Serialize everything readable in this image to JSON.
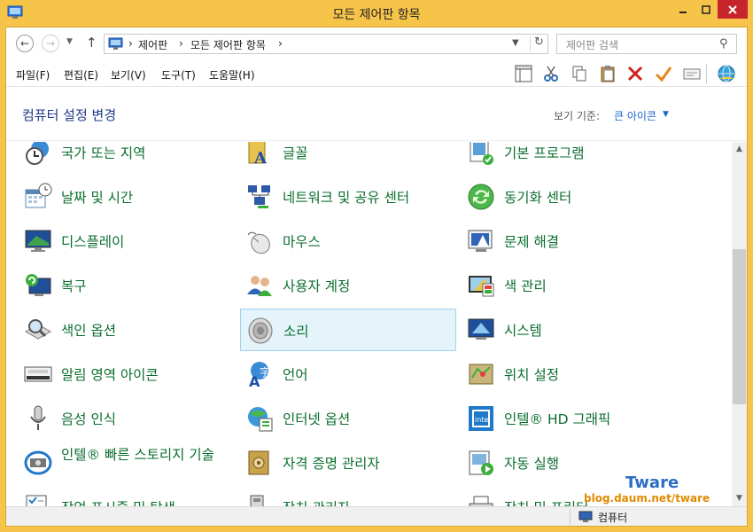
{
  "window": {
    "title": "모든 제어판 항목"
  },
  "nav": {
    "breadcrumbs": [
      "제어판",
      "모든 제어판 항목"
    ],
    "search_placeholder": "제어판 검색"
  },
  "menu": [
    "파일(F)",
    "편집(E)",
    "보기(V)",
    "도구(T)",
    "도움말(H)"
  ],
  "toolbar_icons": [
    "layout-pane-icon",
    "cut-icon",
    "copy-icon",
    "paste-icon",
    "delete-icon",
    "check-icon",
    "properties-icon",
    "globe-icon"
  ],
  "header": {
    "title": "컴퓨터 설정 변경",
    "view_by_label": "보기 기준:",
    "view_by_value": "큰 아이콘"
  },
  "items": [
    {
      "label": "국가 또는 지역",
      "icon": "clock-globe-icon"
    },
    {
      "label": "글꼴",
      "icon": "font-folder-icon"
    },
    {
      "label": "기본 프로그램",
      "icon": "default-programs-icon"
    },
    {
      "label": "날짜 및 시간",
      "icon": "calendar-clock-icon"
    },
    {
      "label": "네트워크 및 공유 센터",
      "icon": "network-icon"
    },
    {
      "label": "동기화 센터",
      "icon": "sync-icon"
    },
    {
      "label": "디스플레이",
      "icon": "display-icon"
    },
    {
      "label": "마우스",
      "icon": "mouse-icon"
    },
    {
      "label": "문제 해결",
      "icon": "troubleshoot-icon"
    },
    {
      "label": "복구",
      "icon": "recovery-icon"
    },
    {
      "label": "사용자 계정",
      "icon": "users-icon"
    },
    {
      "label": "색 관리",
      "icon": "color-management-icon"
    },
    {
      "label": "색인 옵션",
      "icon": "indexing-icon"
    },
    {
      "label": "소리",
      "icon": "speaker-icon",
      "selected": true
    },
    {
      "label": "시스템",
      "icon": "system-icon"
    },
    {
      "label": "알림 영역 아이콘",
      "icon": "notification-area-icon"
    },
    {
      "label": "언어",
      "icon": "language-icon"
    },
    {
      "label": "위치 설정",
      "icon": "location-icon"
    },
    {
      "label": "음성 인식",
      "icon": "microphone-icon"
    },
    {
      "label": "인터넷 옵션",
      "icon": "internet-options-icon"
    },
    {
      "label": "인텔® HD 그래픽",
      "icon": "intel-graphics-icon"
    },
    {
      "label": "인텔® 빠른 스토리지 기술",
      "icon": "intel-storage-icon"
    },
    {
      "label": "자격 증명 관리자",
      "icon": "credential-vault-icon"
    },
    {
      "label": "자동 실행",
      "icon": "autoplay-icon"
    },
    {
      "label": "작업 표시줄 및 탐색",
      "icon": "taskbar-icon"
    },
    {
      "label": "장치 관리자",
      "icon": "device-manager-icon"
    },
    {
      "label": "장치 및 프린터",
      "icon": "printer-icon"
    }
  ],
  "status": {
    "text": "컴퓨터"
  },
  "watermark": {
    "title": "Tware",
    "url": "blog.daum.net/tware"
  }
}
